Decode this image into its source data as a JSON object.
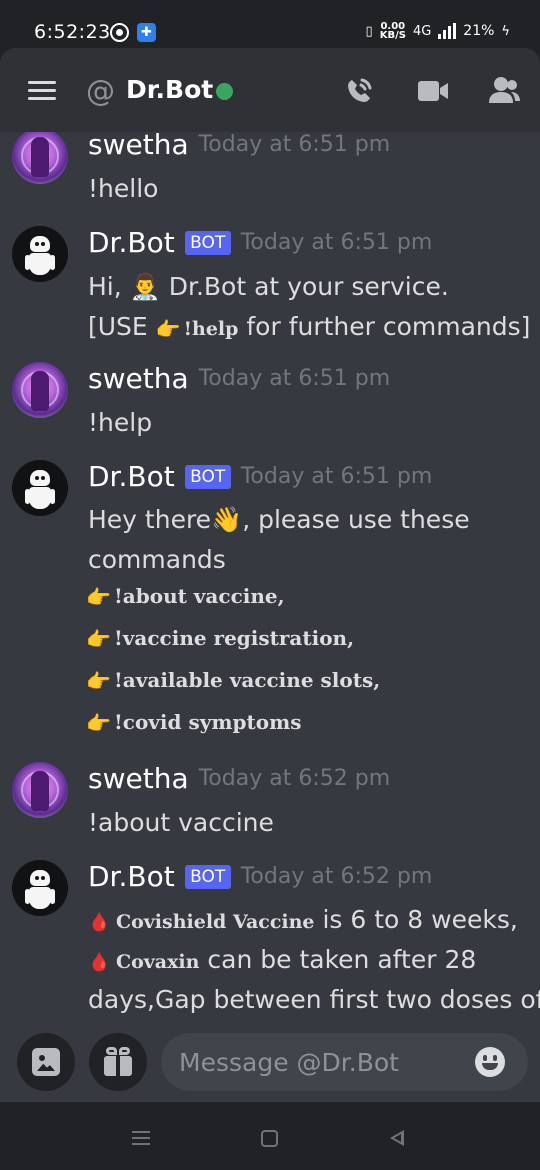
{
  "status": {
    "time": "6:52:23",
    "speed_value": "0.00",
    "speed_unit": "KB/S",
    "network": "4G",
    "battery": "21%"
  },
  "header": {
    "at": "@",
    "channel": "Dr.Bot",
    "online_color": "#3ba55d",
    "icons": [
      "menu-icon",
      "call-icon",
      "video-icon",
      "members-icon"
    ]
  },
  "messages": [
    {
      "author": "swetha",
      "is_bot": false,
      "time": "Today at 6:51 pm",
      "text": "!hello"
    },
    {
      "author": "Dr.Bot",
      "is_bot": true,
      "tag": "BOT",
      "time": "Today at 6:51 pm",
      "line1_pre": "Hi, ",
      "line1_emoji": "👨‍⚕️",
      "line1_post": " Dr.Bot at your service.",
      "line2_pre": "[USE ",
      "line2_emoji": "👉",
      "line2_cmd": "!help",
      "line2_post": "  for further commands]"
    },
    {
      "author": "swetha",
      "is_bot": false,
      "time": "Today at 6:51 pm",
      "text": "!help"
    },
    {
      "author": "Dr.Bot",
      "is_bot": true,
      "tag": "BOT",
      "time": "Today at 6:51 pm",
      "line1_pre": "Hey there",
      "line1_emoji": "👋",
      "line1_post": ", please use these",
      "line2": "commands",
      "commands": [
        "!about vaccine,",
        "!vaccine registration,",
        "!available vaccine slots,",
        "!covid symptoms"
      ],
      "command_emoji": "👉"
    },
    {
      "author": "swetha",
      "is_bot": false,
      "time": "Today at 6:52 pm",
      "text": "!about vaccine"
    },
    {
      "author": "Dr.Bot",
      "is_bot": true,
      "tag": "BOT",
      "time": "Today at 6:52 pm",
      "drop_emoji": "🩸",
      "line1_bold": "Covishield Vaccine",
      "line1_post": " is 6 to 8 weeks,",
      "line2_bold": "Covaxin",
      "line2_post": " can be taken after 28",
      "line3": "days,Gap between first two doses of"
    }
  ],
  "composer": {
    "placeholder": "Message @Dr.Bot",
    "icons": [
      "image-upload-icon",
      "gift-icon",
      "emoji-icon"
    ]
  },
  "navigation": {
    "icons": [
      "recent-apps-icon",
      "home-icon",
      "back-icon"
    ]
  }
}
